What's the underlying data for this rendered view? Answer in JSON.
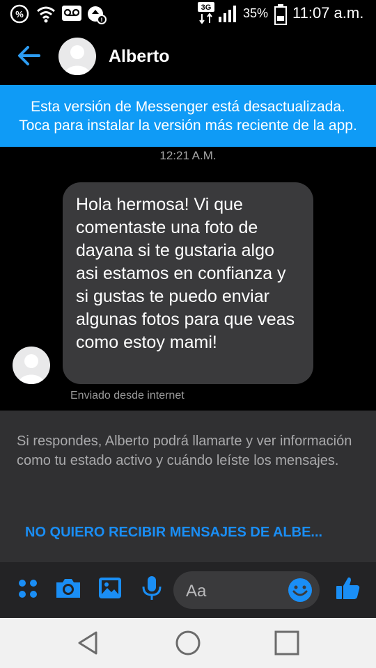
{
  "status_bar": {
    "network_type": "3G",
    "battery_percent": "35%",
    "time": "11:07 a.m.",
    "battery_level": 0.35
  },
  "header": {
    "contact_name": "Alberto",
    "back_icon": "back-arrow-icon"
  },
  "banner": {
    "text": "Esta versión de Messenger está desactualizada. Toca para instalar la versión más reciente de la app."
  },
  "conversation": {
    "timestamp": "12:21 A.M.",
    "messages": [
      {
        "text": "Hola hermosa! Vi que comentaste una foto de dayana si te gustaria algo asi estamos en confianza y si gustas te puedo enviar algunas fotos para que veas como estoy mami!",
        "footer": "Enviado desde internet"
      }
    ]
  },
  "notice": {
    "text": "Si respondes, Alberto podrá llamarte y ver información como tu estado activo y cuándo leíste los mensajes.",
    "block_label": "NO QUIERO RECIBIR MENSAJES DE ALBE..."
  },
  "composer": {
    "placeholder": "Aa",
    "icons": [
      "menu-dots-icon",
      "camera-icon",
      "gallery-icon",
      "microphone-icon",
      "emoji-icon",
      "thumbs-up-icon"
    ]
  },
  "colors": {
    "accent": "#1a8ef5",
    "banner": "#0f9bf6",
    "bubble": "#3a3a3c",
    "background": "#000000"
  }
}
